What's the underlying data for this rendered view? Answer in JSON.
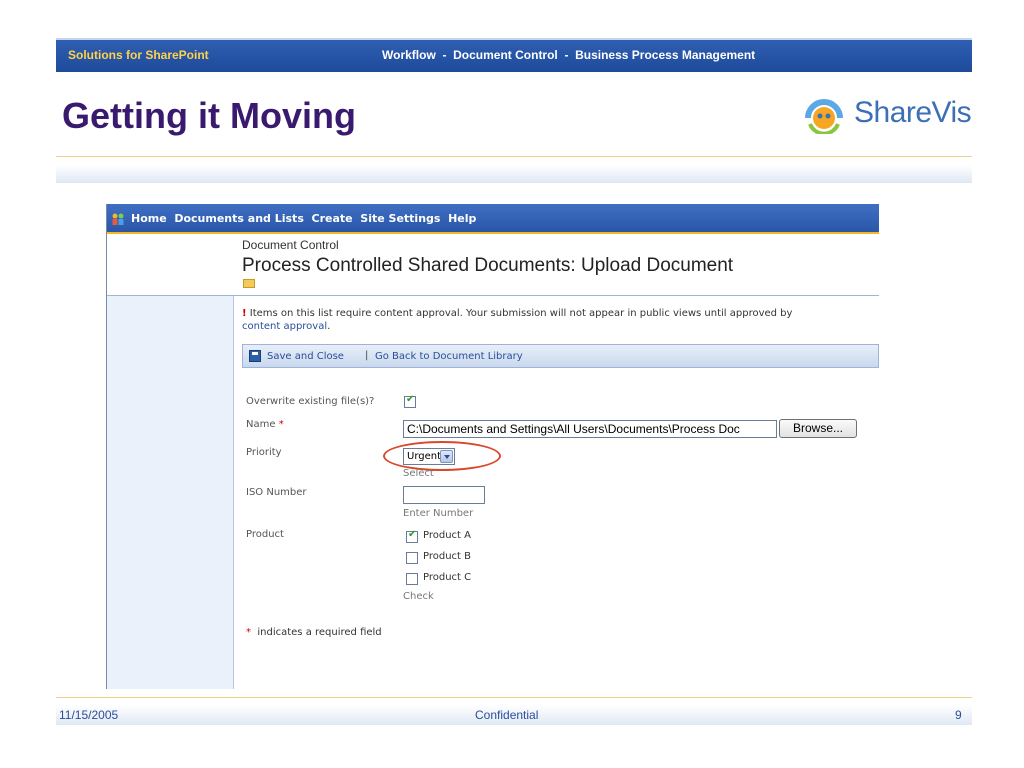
{
  "slide": {
    "header_brand": "Solutions for SharePoint",
    "header_nav": "Workflow  -  Document Control  -  Business Process Management",
    "title": "Getting it Moving",
    "logo_text": "ShareVis"
  },
  "sharepoint": {
    "nav_icon": "people-icon",
    "nav_items": "Home  Documents and Lists  Create  Site Settings  Help",
    "breadcrumb": "Document Control",
    "page_title": "Process Controlled Shared Documents: Upload Document",
    "notice": {
      "mark": "!",
      "text": " Items on this list require content approval. Your submission will not appear in public views until approved by",
      "link": "content approval",
      "end": "."
    },
    "toolbar": {
      "save_label": "Save and Close",
      "separator": "|",
      "back_label": "Go Back to Document Library"
    },
    "form": {
      "overwrite_label": "Overwrite existing file(s)?",
      "overwrite_checked": true,
      "name_label": "Name",
      "required_mark": "*",
      "name_value": "C:\\Documents and Settings\\All Users\\Documents\\Process Doc",
      "browse_label": "Browse...",
      "priority_label": "Priority",
      "priority_value": "Urgent",
      "priority_hint": "Select",
      "iso_label": "ISO Number",
      "iso_value": "",
      "iso_hint": "Enter Number",
      "product_label": "Product",
      "products": [
        {
          "label": "Product A",
          "checked": true
        },
        {
          "label": "Product B",
          "checked": false
        },
        {
          "label": "Product C",
          "checked": false
        }
      ],
      "product_hint": "Check",
      "required_note": "indicates a required field"
    }
  },
  "footer": {
    "date": "11/15/2005",
    "confidential": "Confidential",
    "page": "9"
  },
  "colors": {
    "title": "#3a1a6e",
    "header_bar": "#1e4a9a",
    "brand_yellow": "#ffd24a",
    "highlight_ring": "#d9482b"
  }
}
